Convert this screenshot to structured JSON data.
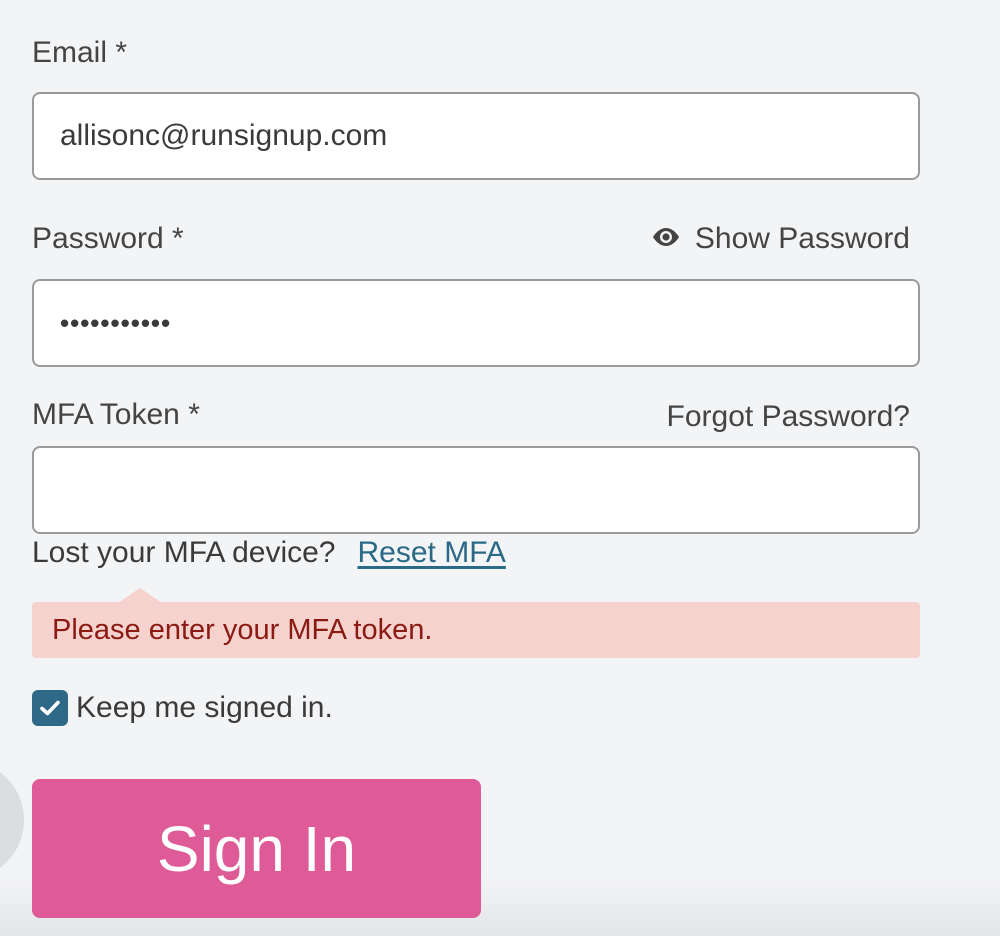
{
  "email": {
    "label": "Email *",
    "value": "allisonc@runsignup.com"
  },
  "password": {
    "label": "Password *",
    "show_password_label": "Show Password",
    "show_password_icon": "eye-icon",
    "masked_value": "•••••••••••"
  },
  "mfa": {
    "label": "MFA Token *",
    "forgot_password_label": "Forgot Password?",
    "value": "",
    "lost_device_text": "Lost your MFA device?",
    "reset_link_label": "Reset MFA",
    "error_message": "Please enter your MFA token."
  },
  "keep_signed_in": {
    "label": "Keep me signed in.",
    "checked": true,
    "check_icon": "checkmark-icon"
  },
  "sign_in_button": {
    "label": "Sign In"
  },
  "colors": {
    "background": "#f3f4f6",
    "button": "#df5b97",
    "link": "#2a6a86",
    "checkbox": "#2e6a88",
    "error_bg": "#f5d2cd",
    "error_text": "#8b1a12"
  }
}
